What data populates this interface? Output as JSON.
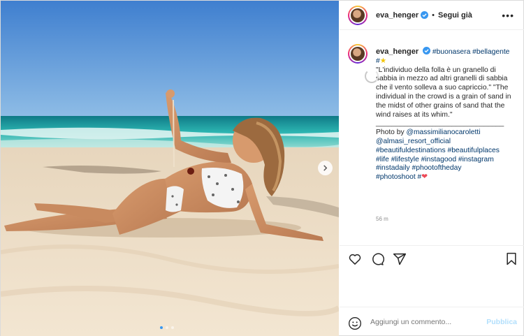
{
  "post": {
    "username": "eva_henger",
    "separator": "•",
    "follow_label": "Segui già",
    "more_label": "•••",
    "caption_tags_line": "#buonasera #bellagente",
    "caption_hash": "#",
    "caption_quote": "\"L'individuo della folla è un granello di sabbia in mezzo ad altri granelli di sabbia che il vento solleva a suo capriccio.\" \"The individual in the crowd is a grain of sand in the midst of other grains of sand that the wind raises at its whim.\"",
    "caption_rule": "________________________________",
    "photo_by": "Photo by",
    "mention_1": "@massimilianocaroletti",
    "mention_2": "@almasi_resort_official",
    "hashtags_1": "#beautifuldestinations #beautifulplaces",
    "hashtags_2": "#life #lifestyle #instagood #instagram",
    "hashtags_3": "#instadaily #phootoftheday",
    "hashtags_4": "#photoshoot #",
    "heart_emoji": "❤",
    "star_emoji": "★",
    "time_ago": "56 m"
  },
  "comment": {
    "placeholder": "Aggiungi un commento...",
    "publish_label": "Pubblica"
  },
  "icons": {
    "verified": "verified-badge-icon",
    "like": "heart-outline-icon",
    "comment": "speech-bubble-icon",
    "share": "paper-plane-icon",
    "save": "bookmark-icon",
    "emoji": "smiley-icon",
    "next": "chevron-right-icon"
  },
  "colors": {
    "link": "#00376b",
    "verified": "#3897f0",
    "publish_disabled": "#b2dffc",
    "heart": "#ed4956"
  },
  "carousel": {
    "slides": 3,
    "active_slide": 1
  }
}
